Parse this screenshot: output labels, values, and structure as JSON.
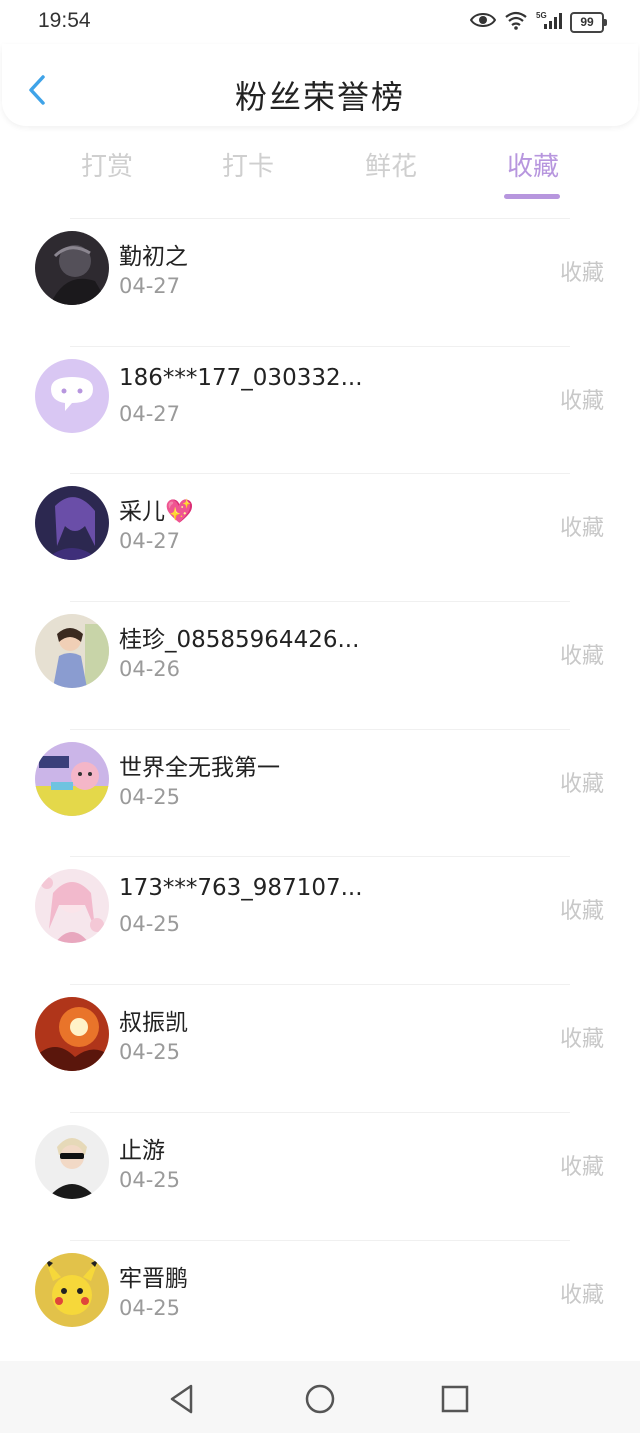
{
  "status": {
    "time": "19:54",
    "battery": "99",
    "signal_label": "5G"
  },
  "header": {
    "title": "粉丝荣誉榜"
  },
  "tabs": [
    {
      "label": "打赏"
    },
    {
      "label": "打卡"
    },
    {
      "label": "鲜花"
    },
    {
      "label": "收藏"
    }
  ],
  "active_tab": "收藏",
  "accent_color": "#b796de",
  "items": [
    {
      "name": "勤初之",
      "date": "04-27",
      "action": "收藏"
    },
    {
      "name": "186***177_030332...",
      "date": "04-27",
      "action": "收藏"
    },
    {
      "name": "采儿💖",
      "date": "04-27",
      "action": "收藏"
    },
    {
      "name": "桂珍_08585964426...",
      "date": "04-26",
      "action": "收藏"
    },
    {
      "name": "世界全无我第一",
      "date": "04-25",
      "action": "收藏"
    },
    {
      "name": "173***763_987107...",
      "date": "04-25",
      "action": "收藏"
    },
    {
      "name": "叔振凯",
      "date": "04-25",
      "action": "收藏"
    },
    {
      "name": "止游",
      "date": "04-25",
      "action": "收藏"
    },
    {
      "name": "牢晋鹏",
      "date": "04-25",
      "action": "收藏"
    }
  ],
  "nav": {
    "back_icon": "triangle-back-icon",
    "home_icon": "circle-home-icon",
    "recents_icon": "square-recents-icon"
  }
}
